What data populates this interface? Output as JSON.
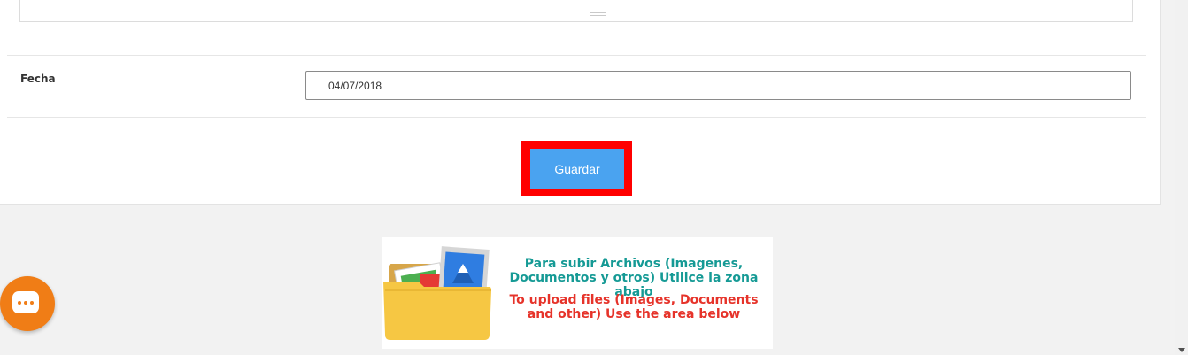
{
  "form": {
    "fecha_label": "Fecha",
    "fecha_value": "04/07/2018",
    "save_label": "Guardar"
  },
  "banner": {
    "spanish_text": "Para subir Archivos (Imagenes, Documentos y otros) Utilice la zona abajo",
    "english_text": "To upload files (Images, Documents and other) Use the area below"
  },
  "icons": {
    "chat": "chat-bubble-icon",
    "folder": "folder-images-icon",
    "resize": "resize-grip-icon",
    "scroll_down": "scroll-down-arrow-icon"
  },
  "colors": {
    "save_button": "#4aa3f0",
    "highlight": "#ff0000",
    "chat_button": "#f07d16",
    "banner_es": "#159a95",
    "banner_en": "#e6332a"
  }
}
